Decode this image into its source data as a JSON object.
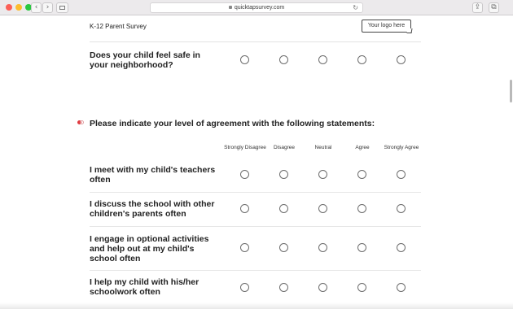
{
  "browser": {
    "url": "quicktapsurvey.com",
    "back_glyph": "‹",
    "forward_glyph": "›",
    "reload_glyph": "↻",
    "share_glyph": "⇪",
    "tabs_glyph": "⧉"
  },
  "header": {
    "title": "K-12 Parent Survey",
    "logo_text": "Your logo here"
  },
  "question1": {
    "text": "Does your child feel safe in your neighborhood?"
  },
  "question2": {
    "text": "Please indicate your level of agreement with the following statements:",
    "columns": [
      "Strongly Disagree",
      "Disagree",
      "Neutral",
      "Agree",
      "Strongly Agree"
    ],
    "rows": [
      "I meet with my child's teachers often",
      "I discuss the school with other children's parents often",
      "I engage in optional activities and help out at my child's school often",
      "I help my child with his/her schoolwork often"
    ]
  },
  "colors": {
    "required_marker": "#e0383e",
    "radio_border": "#6d6d6d"
  }
}
